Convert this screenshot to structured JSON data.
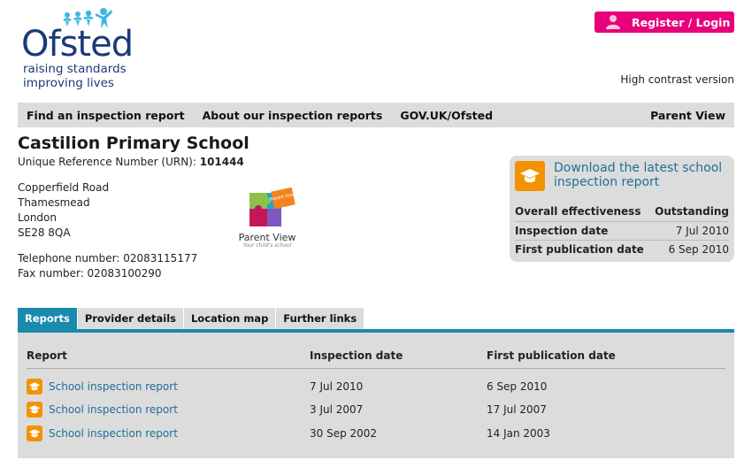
{
  "logo": {
    "word": "Ofsted",
    "tagline_1": "raising standards",
    "tagline_2": "improving lives"
  },
  "header": {
    "register_label": "Register / Login",
    "high_contrast": "High contrast version"
  },
  "nav": {
    "items": [
      "Find an inspection report",
      "About our inspection reports",
      "GOV.UK/Ofsted"
    ],
    "right_item": "Parent View"
  },
  "school": {
    "name": "Castilion Primary School",
    "urn_label": "Unique Reference Number (URN): ",
    "urn": "101444",
    "address": [
      "Copperfield Road",
      "Thamesmead",
      "London",
      "SE28 8QA"
    ],
    "telephone": "Telephone number: 02083115177",
    "fax": "Fax number: 02083100290"
  },
  "parent_view": {
    "title": "Parent View",
    "subtitle": "Your child's school",
    "badge": "Parent View"
  },
  "download": {
    "link": "Download the latest school inspection report",
    "rows": [
      {
        "label": "Overall effectiveness",
        "value": "Outstanding"
      },
      {
        "label": "Inspection date",
        "value": "7 Jul 2010"
      },
      {
        "label": "First publication date",
        "value": "6 Sep 2010"
      }
    ]
  },
  "tabs": [
    "Reports",
    "Provider details",
    "Location map",
    "Further links"
  ],
  "reports": {
    "headers": [
      "Report",
      "Inspection date",
      "First publication date"
    ],
    "rows": [
      {
        "report": "School inspection report",
        "inspection": "7 Jul 2010",
        "publication": "6 Sep 2010"
      },
      {
        "report": "School inspection report",
        "inspection": "3 Jul 2007",
        "publication": "17 Jul 2007"
      },
      {
        "report": "School inspection report",
        "inspection": "30 Sep 2002",
        "publication": "14 Jan 2003"
      }
    ]
  },
  "colors": {
    "accent": "#1a8aad",
    "register": "#e7007a",
    "report_icon": "#f39200",
    "brand": "#1b3a7a"
  }
}
